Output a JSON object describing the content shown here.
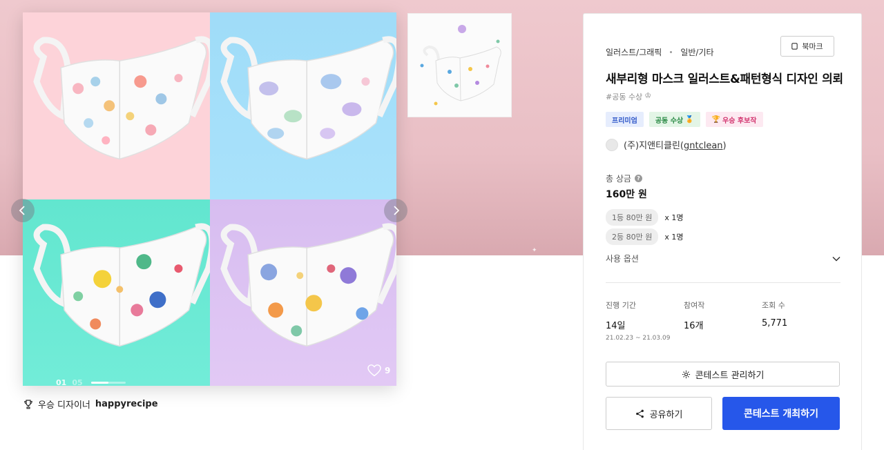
{
  "main_image": {
    "slide_current": "01",
    "slide_total": "05",
    "slide_progress": 0.5,
    "likes": "9"
  },
  "winner": {
    "label": "우승 디자이너",
    "name": "happyrecipe"
  },
  "contest": {
    "category": "일러스트/그래픽",
    "subcategory": "일반/기타",
    "bookmark_label": "북마크",
    "title": "새부리형 마스크 일러스트&패턴형식 디자인 의뢰",
    "hashtag": "#공동 수상",
    "badges": [
      {
        "label": "프리미엄",
        "icon": ""
      },
      {
        "label": "공동 수상",
        "icon": "🏅"
      },
      {
        "label": "우승 후보작",
        "icon": "🏆"
      }
    ],
    "host_name": "(주)지앤티클린",
    "host_id": "gntclean"
  },
  "prize": {
    "label": "총 상금",
    "total": "160만 원",
    "tiers": [
      {
        "label": "1등 80만 원",
        "count": "x 1명"
      },
      {
        "label": "2등 80만 원",
        "count": "x 1명"
      }
    ],
    "options_label": "사용 옵션"
  },
  "stats": {
    "period_label": "진행 기간",
    "period_value": "14일",
    "period_range": "21.02.23 ~ 21.03.09",
    "entries_label": "참여작",
    "entries_value": "16개",
    "views_label": "조회 수",
    "views_value": "5,771"
  },
  "actions": {
    "manage_label": "콘테스트 관리하기",
    "share_label": "공유하기",
    "open_label": "콘테스트 개최하기"
  },
  "colors": {
    "primary_button": "#2657ea",
    "hero_background": "#efc9ce"
  }
}
